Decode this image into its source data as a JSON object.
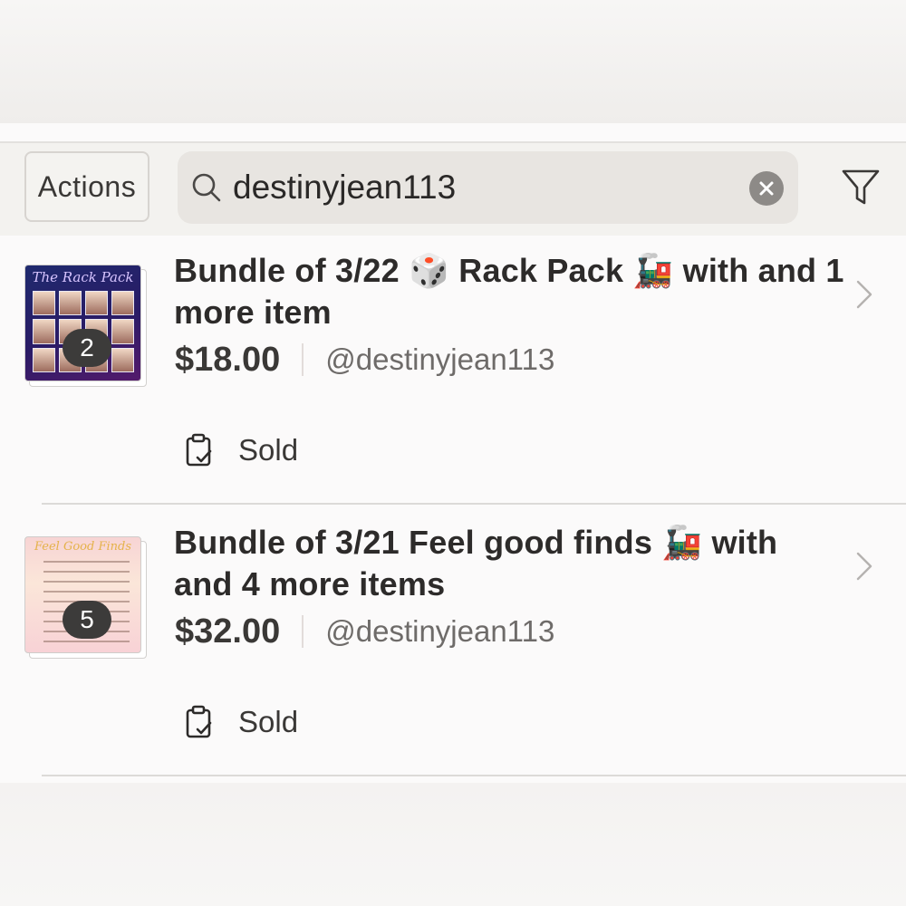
{
  "toolbar": {
    "actions_label": "Actions",
    "search": {
      "query": "destinyjean113",
      "search_icon": "search-icon",
      "clear_icon": "close-icon"
    },
    "filter_icon": "filter-icon"
  },
  "listings": [
    {
      "title": "Bundle of 3/22 🎲 Rack Pack 🚂 with and 1 more item",
      "price": "$18.00",
      "seller": "@destinyjean113",
      "item_count": "2",
      "status": "Sold",
      "thumbnail_caption": "The Rack Pack"
    },
    {
      "title": "Bundle of 3/21 Feel good finds 🚂 with and 4 more items",
      "price": "$32.00",
      "seller": "@destinyjean113",
      "item_count": "5",
      "status": "Sold",
      "thumbnail_caption": "Feel Good Finds"
    }
  ],
  "colors": {
    "panel_background": "#fbfafa",
    "search_field": "#e8e5e1",
    "badge": "#3c3b3a",
    "text_primary": "#2d2b2a",
    "text_secondary": "#6e6b69"
  }
}
